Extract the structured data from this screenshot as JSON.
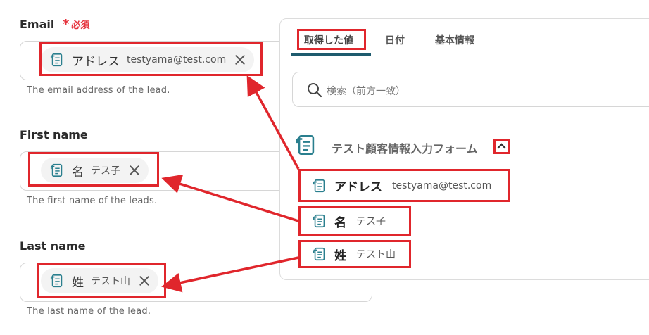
{
  "fields": {
    "email": {
      "label": "Email",
      "required_mark": "*",
      "required_text": "必須",
      "chip_token": "アドレス",
      "chip_value": "testyama@test.com",
      "help": "The email address of the lead."
    },
    "first_name": {
      "label": "First name",
      "chip_token": "名",
      "chip_value": "テス子",
      "help": "The first name of the leads."
    },
    "last_name": {
      "label": "Last name",
      "chip_token": "姓",
      "chip_value": "テスト山",
      "help": "The last name of the lead."
    }
  },
  "panel": {
    "tabs": [
      {
        "label": "取得した値"
      },
      {
        "label": "日付"
      },
      {
        "label": "基本情報"
      }
    ],
    "search_placeholder": "検索（前方一致）",
    "group_title": "テスト顧客情報入力フォーム",
    "items": [
      {
        "token": "アドレス",
        "value": "testyama@test.com"
      },
      {
        "token": "名",
        "value": "テス子"
      },
      {
        "token": "姓",
        "value": "テスト山"
      }
    ]
  },
  "colors": {
    "accent_red": "#e0262c",
    "tab_underline": "#1e5b6e",
    "icon_teal": "#2a7f8e"
  },
  "icons": [
    "form-icon",
    "close-icon",
    "search-icon",
    "chevron-up-icon",
    "arrow"
  ]
}
